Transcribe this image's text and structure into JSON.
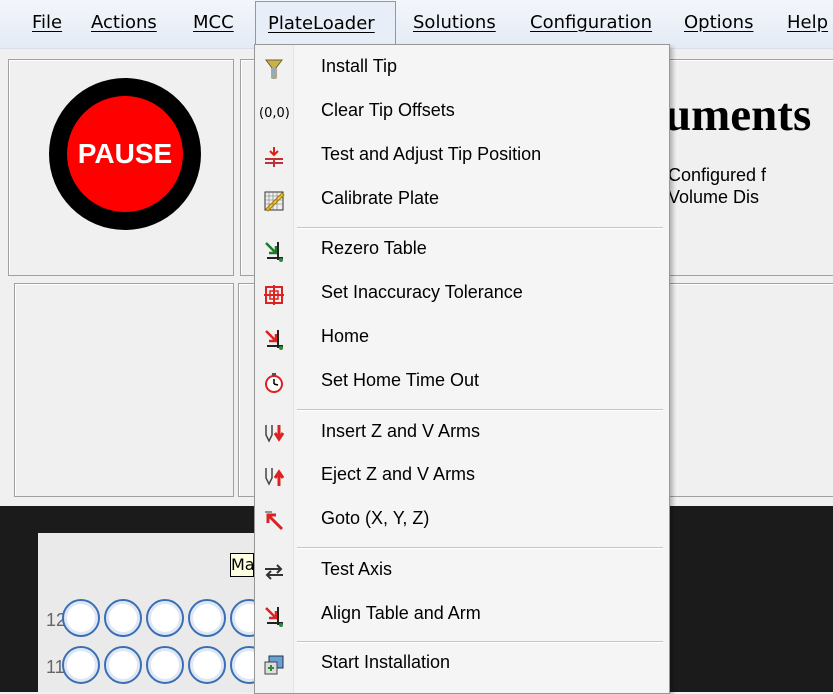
{
  "menubar": {
    "items": [
      "File",
      "Actions",
      "MCC",
      "PlateLoader",
      "Solutions",
      "Configuration",
      "Options",
      "Help"
    ]
  },
  "main": {
    "pause_label": "PAUSE",
    "title": "uments",
    "subtitle1": "Configured f",
    "subtitle2": "Volume Dis"
  },
  "plate": {
    "tooltip": "Ma",
    "row_labels": [
      "12",
      "11"
    ]
  },
  "dropdown": {
    "items": [
      {
        "label": "Install Tip",
        "icon": "install-tip-icon"
      },
      {
        "label": "(0,0)",
        "icon": "tip-offset-icon"
      },
      {
        "label": "Clear Tip Offsets",
        "icon": "tip-offset-icon"
      },
      {
        "label": "Test and Adjust Tip Position",
        "icon": "adjust-tip-icon"
      },
      {
        "label": "Calibrate Plate",
        "icon": "calibrate-plate-icon"
      },
      {
        "label": "Rezero Table",
        "icon": "rezero-icon"
      },
      {
        "label": "Set Inaccuracy Tolerance",
        "icon": "crosshair-icon"
      },
      {
        "label": "Home",
        "icon": "home-arrow-icon"
      },
      {
        "label": "Set Home Time Out",
        "icon": "stopwatch-icon"
      },
      {
        "label": "Insert Z and V Arms",
        "icon": "insert-arms-icon"
      },
      {
        "label": "Eject Z and V Arms",
        "icon": "eject-arms-icon"
      },
      {
        "label": "Goto (X, Y, Z)",
        "icon": "goto-xyz-icon"
      },
      {
        "label": "Test Axis",
        "icon": "test-axis-icon"
      },
      {
        "label": "Align Table and Arm",
        "icon": "align-icon"
      },
      {
        "label": "Start Installation",
        "icon": "installation-icon"
      }
    ]
  }
}
